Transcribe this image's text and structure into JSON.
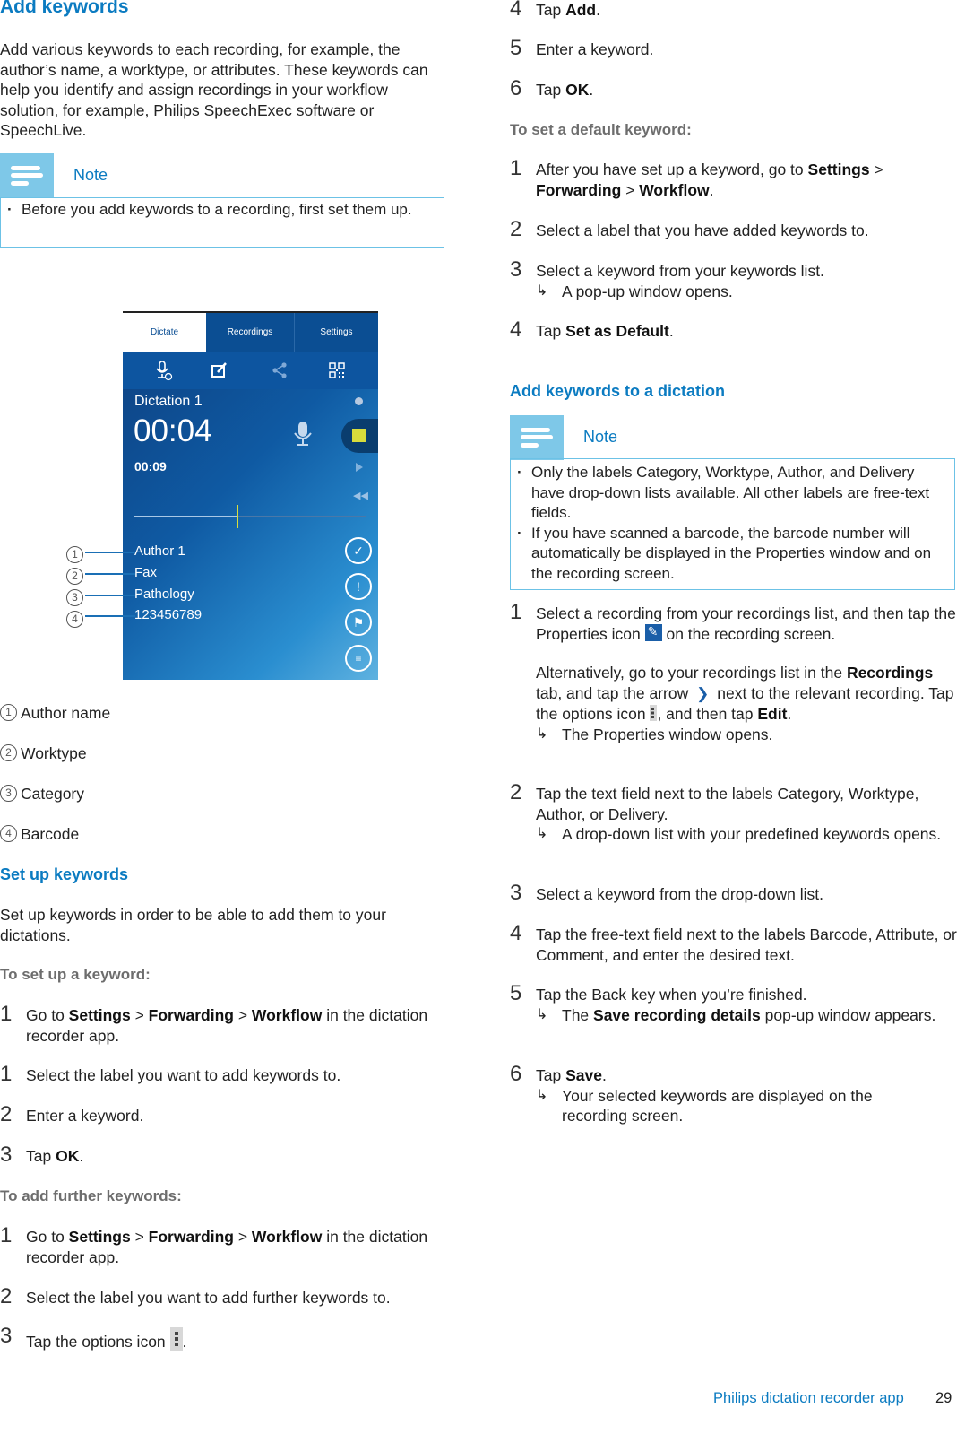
{
  "left": {
    "title": "Add keywords",
    "intro": "Add various keywords to each recording, for example, the author’s name, a worktype, or attributes. These keywords can help you identify and assign recordings in your workflow solution, for example, Philips SpeechExec software or SpeechLive.",
    "note1": {
      "label": "Note",
      "items": [
        "Before you add keywords to a recording, first set them up."
      ]
    },
    "phone": {
      "tabs": [
        "Dictate",
        "Recordings",
        "Settings"
      ],
      "active_tab": "Dictate",
      "toolbar_icons": [
        "microphone-add-icon",
        "properties-edit-icon",
        "share-icon",
        "qr-code-icon"
      ],
      "dictation_name": "Dictation 1",
      "elapsed": "00:04",
      "total": "00:09",
      "position_fraction": 0.44,
      "keywords": [
        "Author 1",
        "Fax",
        "Pathology",
        "123456789"
      ],
      "side_icons": [
        "check-icon",
        "priority-icon",
        "flag-icon",
        "delete-icon"
      ],
      "accent_color": "#d8dc3c"
    },
    "callouts": [
      "1",
      "2",
      "3",
      "4"
    ],
    "legend": [
      {
        "num": "1",
        "label": "Author name"
      },
      {
        "num": "2",
        "label": "Worktype"
      },
      {
        "num": "3",
        "label": "Category"
      },
      {
        "num": "4",
        "label": "Barcode"
      }
    ],
    "setup_title": "Set up keywords",
    "setup_intro": "Set up keywords in order to be able to add them to your dictations.",
    "setup_sub": "To set up a keyword:",
    "setup_steps": [
      {
        "num": "1",
        "pre": "Go to ",
        "b1": "Settings",
        "s1": " > ",
        "b2": "Forwarding",
        "s2": " > ",
        "b3": "Workflow",
        "post": " in the dictation recorder app."
      },
      {
        "num": "1",
        "text": "Select the label you want to add keywords to."
      },
      {
        "num": "2",
        "text": "Enter a keyword."
      },
      {
        "num": "3",
        "pre": "Tap ",
        "b1": "OK",
        "post": "."
      }
    ],
    "further_sub": "To add further keywords:",
    "further_steps": [
      {
        "num": "1",
        "pre": "Go to ",
        "b1": "Settings",
        "s1": " > ",
        "b2": "Forwarding",
        "s2": " > ",
        "b3": "Workflow",
        "post": " in the dictation recorder app."
      },
      {
        "num": "2",
        "text": "Select the label you want to add further keywords to."
      },
      {
        "num": "3",
        "pre": "Tap the options icon ",
        "post": "."
      }
    ]
  },
  "right": {
    "further_steps_cont": [
      {
        "num": "4",
        "pre": "Tap ",
        "b1": "Add",
        "post": "."
      },
      {
        "num": "5",
        "text": "Enter a keyword."
      },
      {
        "num": "6",
        "pre": "Tap ",
        "b1": "OK",
        "post": "."
      }
    ],
    "default_sub": "To set a default keyword:",
    "default_steps": [
      {
        "num": "1",
        "pre": "After you have set up a keyword, go to ",
        "b1": "Settings",
        "s1": " > ",
        "b2": "Forwarding",
        "s2": " > ",
        "b3": "Workflow",
        "post": "."
      },
      {
        "num": "2",
        "text": "Select a label that you have added keywords to."
      },
      {
        "num": "3",
        "text": "Select a keyword from your keywords list.",
        "result": "A pop-up window opens."
      },
      {
        "num": "4",
        "pre": "Tap ",
        "b1": "Set as Default",
        "post": "."
      }
    ],
    "dictation_title": "Add keywords to a dictation",
    "note2": {
      "label": "Note",
      "items": [
        "Only the labels Category, Worktype, Author, and Delivery have drop-down lists available. All other labels are free-text fields.",
        "If you have scanned a barcode, the barcode number will automatically be displayed in the Properties window and on the recording screen."
      ]
    },
    "dictation_steps": [
      {
        "num": "1",
        "line1_pre": "Select a recording from your recordings list, and then tap the Properties icon ",
        "line1_post": " on the recording screen.",
        "alt_pre": "Alternatively, go to your recordings list in the ",
        "alt_b1": "Recordings",
        "alt_mid1": " tab, and tap the arrow ",
        "alt_mid2": " next to the relevant recording. Tap the options icon ",
        "alt_mid3": ", and then tap ",
        "alt_b2": "Edit",
        "alt_post": ".",
        "result": "The Properties window opens."
      },
      {
        "num": "2",
        "text": "Tap the text field next to the labels Category, Worktype, Author, or Delivery.",
        "result": "A drop-down list with your predefined keywords opens."
      },
      {
        "num": "3",
        "text": "Select a keyword from the drop-down list."
      },
      {
        "num": "4",
        "text": "Tap the free-text field next to the labels Barcode, Attribute, or Comment, and enter the desired text."
      },
      {
        "num": "5",
        "text": "Tap the Back key when you’re finished.",
        "result_pre": "The ",
        "result_b": "Save recording details",
        "result_post": " pop-up window appears."
      },
      {
        "num": "6",
        "pre": "Tap ",
        "b1": "Save",
        "post": ".",
        "result": "Your selected keywords are displayed on the recording screen."
      }
    ]
  },
  "footer": {
    "title": "Philips dictation recorder app",
    "page": "29"
  },
  "symbols": {
    "result_arrow": "↳",
    "chevron": "❯"
  }
}
